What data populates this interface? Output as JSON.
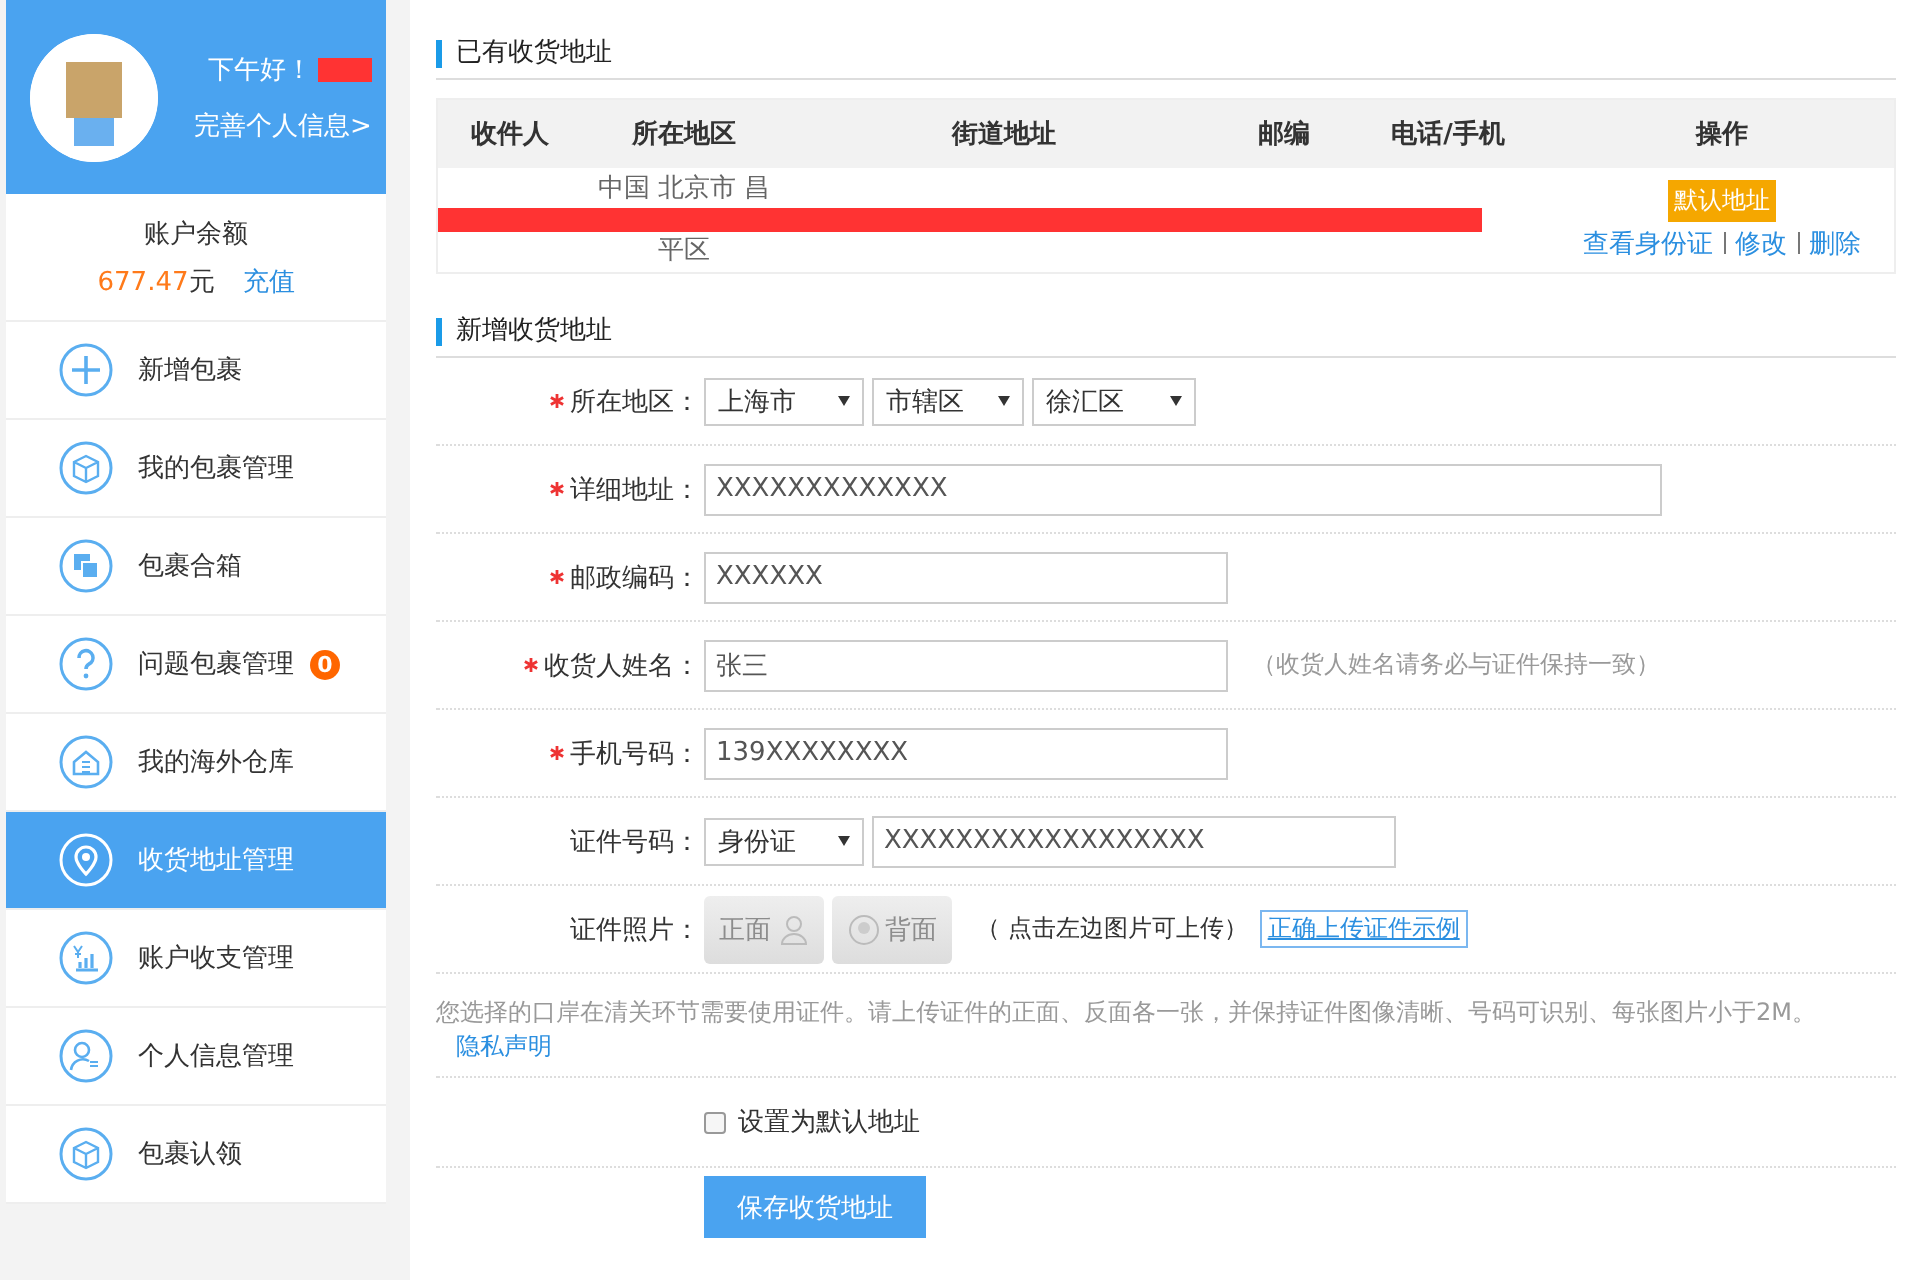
{
  "sidebar": {
    "greeting": "下午好！",
    "profile_link": "完善个人信息>",
    "balance_label": "账户余额",
    "balance_amount": "677.47",
    "balance_unit": "元",
    "recharge": "充值",
    "items": [
      {
        "label": "新增包裹",
        "kind": "plus",
        "selected": false
      },
      {
        "label": "我的包裹管理",
        "kind": "box",
        "selected": false
      },
      {
        "label": "包裹合箱",
        "kind": "merge",
        "selected": false
      },
      {
        "label": "问题包裹管理",
        "kind": "question",
        "badge": "0",
        "selected": false
      },
      {
        "label": "我的海外仓库",
        "kind": "house",
        "selected": false
      },
      {
        "label": "收货地址管理",
        "kind": "pin",
        "selected": true
      },
      {
        "label": "账户收支管理",
        "kind": "chart",
        "selected": false
      },
      {
        "label": "个人信息管理",
        "kind": "person",
        "selected": false
      },
      {
        "label": "包裹认领",
        "kind": "box",
        "selected": false
      }
    ]
  },
  "existing": {
    "title": "已有收货地址",
    "columns": [
      "收件人",
      "所在地区",
      "街道地址",
      "邮编",
      "电话/手机",
      "操作"
    ],
    "rows": [
      {
        "region_lines": [
          "中国 北京市 昌",
          "平区"
        ],
        "is_default": true,
        "default_label": "默认地址",
        "actions": [
          "查看身份证",
          "修改",
          "删除"
        ]
      }
    ]
  },
  "form": {
    "title": "新增收货地址",
    "fields": [
      {
        "kind": "selects",
        "label": "所在地区：",
        "required": true,
        "selects": [
          "上海市",
          "市辖区",
          "徐汇区"
        ]
      },
      {
        "kind": "text",
        "label": "详细地址：",
        "required": true,
        "value": "XXXXXXXXXXXXX",
        "wide": true
      },
      {
        "kind": "text",
        "label": "邮政编码：",
        "required": true,
        "value": "XXXXXX",
        "wide": false
      },
      {
        "kind": "text",
        "label": "收货人姓名：",
        "required": true,
        "value": "张三",
        "wide": false,
        "hint": "（收货人姓名请务必与证件保持一致）"
      },
      {
        "kind": "text",
        "label": "手机号码：",
        "required": true,
        "value": "139XXXXXXXX",
        "wide": false
      },
      {
        "kind": "id",
        "label": "证件号码：",
        "required": false,
        "id_type": "身份证",
        "value": "XXXXXXXXXXXXXXXXXX"
      },
      {
        "kind": "photos",
        "label": "证件照片：",
        "required": false,
        "front": "正面",
        "back": "背面",
        "hint": "（ 点击左边图片可上传）",
        "example_link": "正确上传证件示例"
      }
    ],
    "notice": "您选择的口岸在清关环节需要使用证件。请上传证件的正面、反面各一张，并保持证件图像清晰、号码可识别、每张图片小于2M。",
    "notice_link": "隐私声明",
    "default_checkbox": {
      "label": "设置为默认地址",
      "checked": false
    },
    "submit": "保存收货地址"
  }
}
